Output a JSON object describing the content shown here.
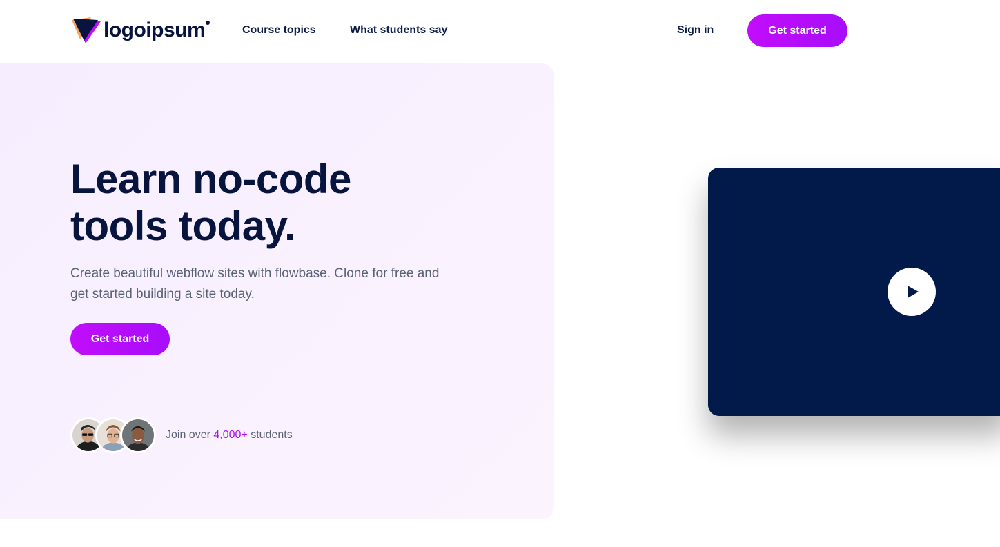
{
  "brand": {
    "name": "logoipsum",
    "logo_icon": "logo-triangle-icon",
    "colors": {
      "navy": "#07143d",
      "purple": "#a80dfa",
      "magenta": "#c10dfb",
      "orange": "#f7a35c",
      "video_bg": "#011a4a",
      "panel_bg": "#f8f0fe"
    }
  },
  "nav": {
    "links": [
      {
        "label": "Course topics"
      },
      {
        "label": "What students say"
      }
    ],
    "sign_in": "Sign in",
    "cta": "Get started"
  },
  "hero": {
    "title": "Learn no-code tools today.",
    "subtitle": "Create beautiful webflow sites with flowbase. Clone for free and get started building a site today.",
    "cta": "Get started",
    "students": {
      "prefix": "Join over",
      "count": "4,000+",
      "suffix": "students"
    }
  },
  "video": {
    "play_icon": "play-icon"
  }
}
